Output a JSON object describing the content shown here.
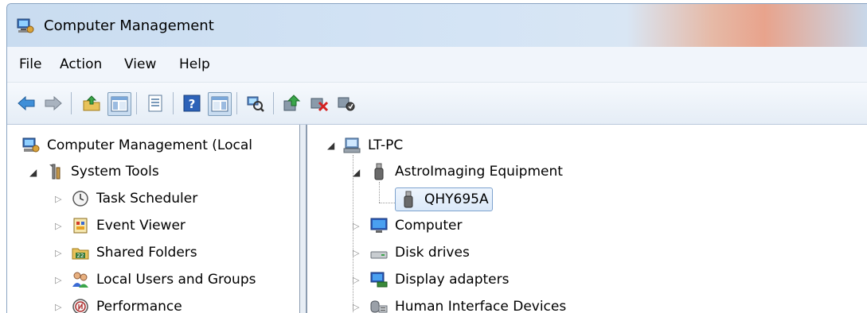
{
  "window": {
    "title": "Computer Management",
    "title_icon": "computer-management-icon"
  },
  "menu": [
    "File",
    "Action",
    "View",
    "Help"
  ],
  "toolbar": {
    "buttons": [
      "back-arrow-icon",
      "forward-arrow-icon",
      "up-folder-icon",
      "show-hide-tree-icon",
      "properties-icon",
      "help-icon",
      "show-hide-action-pane-icon",
      "scan-hardware-icon",
      "update-driver-icon",
      "uninstall-device-icon",
      "disable-device-icon"
    ]
  },
  "left_tree": [
    {
      "label": "Computer Management (Local",
      "icon": "computer-management-icon",
      "expander": "none"
    },
    {
      "label": "System Tools",
      "icon": "system-tools-icon",
      "expander": "open"
    },
    {
      "label": "Task Scheduler",
      "icon": "clock-icon",
      "expander": "closed"
    },
    {
      "label": "Event Viewer",
      "icon": "event-viewer-icon",
      "expander": "closed"
    },
    {
      "label": "Shared Folders",
      "icon": "shared-folders-icon",
      "expander": "closed"
    },
    {
      "label": "Local Users and Groups",
      "icon": "users-icon",
      "expander": "closed"
    },
    {
      "label": "Performance",
      "icon": "performance-icon",
      "expander": "closed"
    }
  ],
  "right_tree": [
    {
      "label": "LT-PC",
      "icon": "computer-icon",
      "expander": "open"
    },
    {
      "label": "AstroImaging Equipment",
      "icon": "usb-device-icon",
      "expander": "open"
    },
    {
      "label": "QHY695A",
      "icon": "usb-device-icon",
      "expander": "none",
      "selected": true
    },
    {
      "label": "Computer",
      "icon": "monitor-icon",
      "expander": "closed"
    },
    {
      "label": "Disk drives",
      "icon": "disk-drive-icon",
      "expander": "closed"
    },
    {
      "label": "Display adapters",
      "icon": "display-adapter-icon",
      "expander": "closed"
    },
    {
      "label": "Human Interface Devices",
      "icon": "hid-icon",
      "expander": "closed"
    }
  ],
  "colors": {
    "selection_border": "#7da2ce",
    "selection_fill": "#dbe9f9",
    "toolbar_bg": "#e5edf6"
  }
}
